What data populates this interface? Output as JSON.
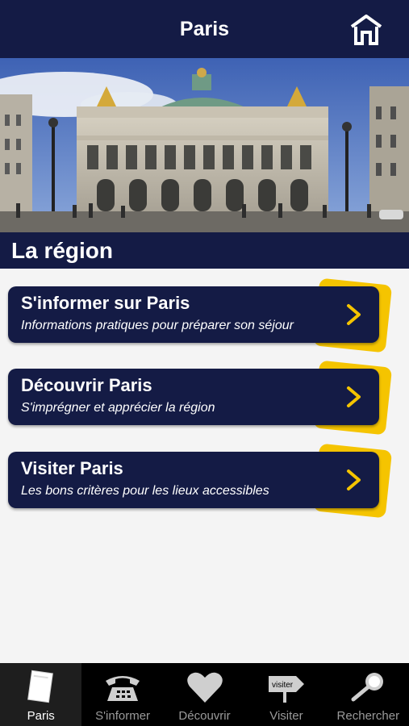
{
  "header": {
    "title": "Paris",
    "home_icon": "home-icon"
  },
  "hero": {
    "image": "palais-garnier-photo"
  },
  "section": {
    "title": "La région"
  },
  "menu": [
    {
      "title": "S'informer sur Paris",
      "subtitle": "Informations pratiques pour préparer son séjour"
    },
    {
      "title": "Découvrir Paris",
      "subtitle": "S'imprégner et apprécier la région"
    },
    {
      "title": "Visiter Paris",
      "subtitle": "Les bons critères pour les lieux accessibles"
    }
  ],
  "tabs": [
    {
      "label": "Paris",
      "icon": "document-icon",
      "active": true
    },
    {
      "label": "S'informer",
      "icon": "telephone-icon",
      "active": false
    },
    {
      "label": "Découvrir",
      "icon": "heart-icon",
      "active": false
    },
    {
      "label": "Visiter",
      "icon": "signpost-icon",
      "sign_text": "visiter",
      "active": false
    },
    {
      "label": "Rechercher",
      "icon": "magnifier-icon",
      "active": false
    }
  ],
  "colors": {
    "navy": "#141b45",
    "accent": "#f5c400",
    "tab_bg": "#000000"
  }
}
